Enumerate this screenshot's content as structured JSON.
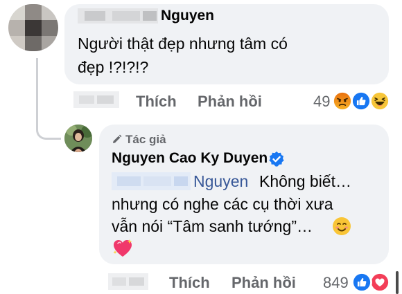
{
  "comment": {
    "author_suffix": "Nguyen",
    "text_line1": "Người thật đẹp nhưng tâm có",
    "text_line2": "đẹp !?!?!?",
    "like_label": "Thích",
    "reply_label": "Phản hồi",
    "reaction_count": "49",
    "reactions": [
      "angry",
      "like",
      "haha"
    ]
  },
  "reply": {
    "badge_label": "Tác giả",
    "author": "Nguyen Cao Ky Duyen",
    "verified": true,
    "mention_suffix": "Nguyen",
    "text_part1": "Không biết…",
    "text_line2": "nhưng có nghe các cụ thời xưa",
    "text_line3": "vẫn nói “Tâm sanh tướng”…",
    "emoji1": "😊",
    "emoji2": "💖",
    "like_label": "Thích",
    "reply_label": "Phản hồi",
    "reaction_count": "849",
    "reactions": [
      "like",
      "love"
    ]
  },
  "colors": {
    "bubble": "#f0f2f5",
    "meta": "#65676b",
    "mention": "#385898",
    "verified": "#1877f2"
  }
}
